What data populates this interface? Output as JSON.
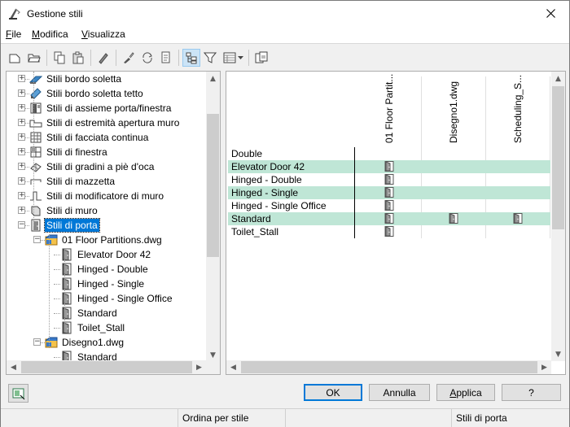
{
  "window": {
    "title": "Gestione stili"
  },
  "menu": [
    {
      "key": "F",
      "rest": "ile"
    },
    {
      "key": "M",
      "rest": "odifica"
    },
    {
      "key": "V",
      "rest": "isualizza"
    }
  ],
  "tree": {
    "items": [
      {
        "label": "Stili bordo soletta",
        "icon": "slab-edge-icon"
      },
      {
        "label": "Stili bordo soletta tetto",
        "icon": "roof-slab-edge-icon"
      },
      {
        "label": "Stili di assieme porta/finestra",
        "icon": "door-window-assembly-icon"
      },
      {
        "label": "Stili di estremità apertura muro",
        "icon": "wall-opening-endcap-icon"
      },
      {
        "label": "Stili di facciata continua",
        "icon": "curtain-wall-icon"
      },
      {
        "label": "Stili di finestra",
        "icon": "window-icon"
      },
      {
        "label": "Stili di gradini a piè d'oca",
        "icon": "winder-stair-icon"
      },
      {
        "label": "Stili di mazzetta",
        "icon": "jamb-icon"
      },
      {
        "label": "Stili di modificatore di muro",
        "icon": "wall-modifier-icon"
      },
      {
        "label": "Stili di muro",
        "icon": "wall-icon"
      },
      {
        "label": "Stili di porta",
        "icon": "door-folder-icon",
        "selected": true
      },
      {
        "label": "01 Floor Partitions.dwg",
        "icon": "drawing-file-icon"
      },
      {
        "label": "Elevator Door 42",
        "icon": "door-icon"
      },
      {
        "label": "Hinged - Double",
        "icon": "door-icon"
      },
      {
        "label": "Hinged - Single",
        "icon": "door-icon"
      },
      {
        "label": "Hinged - Single Office",
        "icon": "door-icon"
      },
      {
        "label": "Standard",
        "icon": "door-icon"
      },
      {
        "label": "Toilet_Stall",
        "icon": "door-icon"
      },
      {
        "label": "Disegno1.dwg",
        "icon": "drawing-file-icon"
      },
      {
        "label": "Standard",
        "icon": "door-icon"
      }
    ]
  },
  "grid": {
    "columns": [
      "01 Floor Partit...",
      "Disegno1.dwg",
      "Scheduling_S..."
    ],
    "rows": [
      {
        "name": "Double",
        "cells": [
          false,
          false,
          false
        ]
      },
      {
        "name": "Elevator Door 42",
        "cells": [
          true,
          false,
          false
        ]
      },
      {
        "name": "Hinged - Double",
        "cells": [
          true,
          false,
          false
        ]
      },
      {
        "name": "Hinged - Single",
        "cells": [
          true,
          false,
          false
        ]
      },
      {
        "name": "Hinged - Single Office",
        "cells": [
          true,
          false,
          false
        ]
      },
      {
        "name": "Standard",
        "cells": [
          true,
          true,
          true
        ]
      },
      {
        "name": "Toilet_Stall",
        "cells": [
          true,
          false,
          false
        ]
      }
    ]
  },
  "buttons": {
    "ok": "OK",
    "cancel": "Annulla",
    "apply_key": "A",
    "apply_rest": "pplica",
    "help": "?"
  },
  "status": {
    "sort": "Ordina per stile",
    "current": "Stili di porta"
  },
  "colors": {
    "selection": "#0078d7",
    "grid_highlight": "#bfe6d6"
  }
}
